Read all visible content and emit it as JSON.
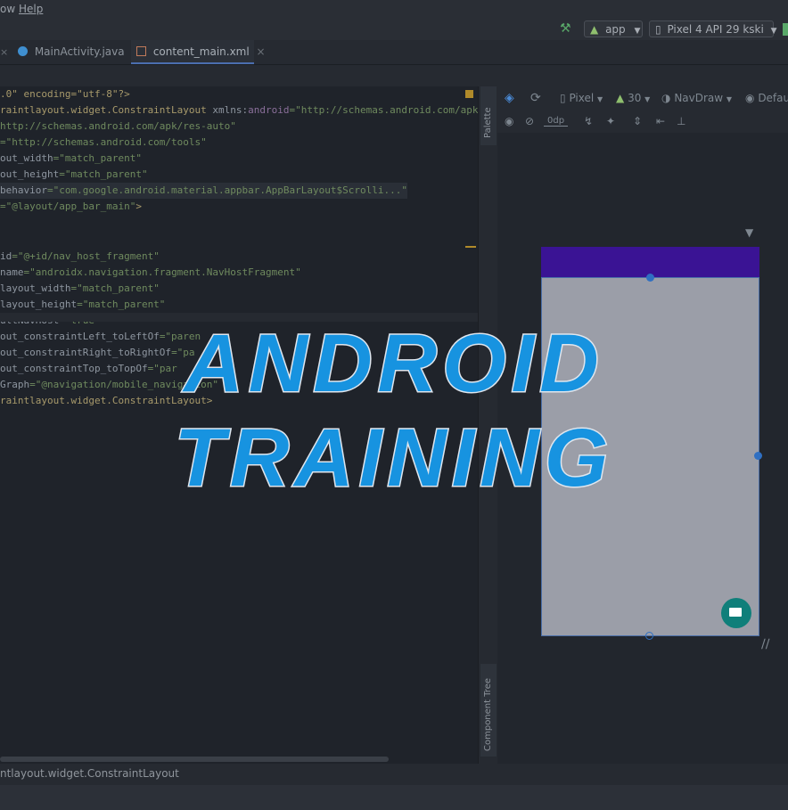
{
  "menu": {
    "partial": "ow",
    "help": "Help"
  },
  "toolbar": {
    "run_config": "app",
    "device": "Pixel 4 API 29 kski"
  },
  "tabs": [
    {
      "label": "MainActivity.java"
    },
    {
      "label": "content_main.xml"
    }
  ],
  "code_lines": [
    {
      "parts": [
        {
          "t": ".0\" encoding=\"utf-8\"?>",
          "c": "tag"
        }
      ]
    },
    {
      "parts": [
        {
          "t": "raintlayout.widget.ConstraintLayout ",
          "c": "tag"
        },
        {
          "t": "xmlns:",
          "c": "attr"
        },
        {
          "t": "android",
          "c": "ns"
        },
        {
          "t": "=\"http://schemas.android.com/apk/res",
          "c": "str"
        }
      ]
    },
    {
      "parts": [
        {
          "t": "http://schemas.android.com/apk/res-auto\"",
          "c": "str"
        }
      ]
    },
    {
      "parts": [
        {
          "t": "=\"http://schemas.android.com/tools\"",
          "c": "str"
        }
      ]
    },
    {
      "parts": [
        {
          "t": "out_width",
          "c": "attr"
        },
        {
          "t": "=\"match_parent\"",
          "c": "str"
        }
      ]
    },
    {
      "parts": [
        {
          "t": "out_height",
          "c": "attr"
        },
        {
          "t": "=\"match_parent\"",
          "c": "str"
        }
      ]
    },
    {
      "parts": [
        {
          "t": "behavior",
          "c": "attr"
        },
        {
          "t": "=\"com.google.android.material.appbar.AppBarLayout$Scrolli...\"",
          "c": "str"
        }
      ]
    },
    {
      "parts": [
        {
          "t": "=\"@layout/app_bar_main\"",
          "c": "str"
        },
        {
          "t": ">",
          "c": "tag"
        }
      ]
    },
    {
      "parts": []
    },
    {
      "parts": []
    },
    {
      "parts": [
        {
          "t": "id",
          "c": "attr"
        },
        {
          "t": "=\"@+id/nav_host_fragment\"",
          "c": "str"
        }
      ]
    },
    {
      "parts": [
        {
          "t": "name",
          "c": "attr"
        },
        {
          "t": "=\"androidx.navigation.fragment.NavHostFragment\"",
          "c": "str"
        }
      ]
    },
    {
      "parts": [
        {
          "t": "layout_width",
          "c": "attr"
        },
        {
          "t": "=\"match_parent\"",
          "c": "str"
        }
      ]
    },
    {
      "parts": [
        {
          "t": "layout_height",
          "c": "attr"
        },
        {
          "t": "=\"match_parent\"",
          "c": "str"
        }
      ]
    },
    {
      "parts": [
        {
          "t": "ultNavHost",
          "c": "attr"
        },
        {
          "t": "=\"true\"",
          "c": "str"
        }
      ]
    },
    {
      "parts": [
        {
          "t": "out_constraintLeft_toLeftOf",
          "c": "attr"
        },
        {
          "t": "=\"paren",
          "c": "str"
        }
      ]
    },
    {
      "parts": [
        {
          "t": "out_constraintRight_toRightOf",
          "c": "attr"
        },
        {
          "t": "=\"pa",
          "c": "str"
        }
      ]
    },
    {
      "parts": [
        {
          "t": "out_constraintTop_toTopOf",
          "c": "attr"
        },
        {
          "t": "=\"par",
          "c": "str"
        }
      ]
    },
    {
      "parts": [
        {
          "t": "Graph",
          "c": "attr"
        },
        {
          "t": "=\"@navigation/mobile_navigation\"",
          "c": "str"
        }
      ]
    },
    {
      "parts": [
        {
          "t": "raintlayout.widget.ConstraintLayout>",
          "c": "tag"
        }
      ]
    }
  ],
  "design_toolbar": {
    "device": "Pixel",
    "api": "30",
    "theme": "NavDraw",
    "locale": "Defau",
    "margin": "0dp"
  },
  "side_panels": {
    "palette": "Palette",
    "component_tree": "Component Tree"
  },
  "status_bar": {
    "path": "ntlayout.widget.ConstraintLayout"
  },
  "overlay": {
    "line1": "ANDROID",
    "line2": "TRAINING"
  },
  "colors": {
    "accent": "#1793e0",
    "app_bar": "#3a1394",
    "fab": "#0f7f7a"
  }
}
